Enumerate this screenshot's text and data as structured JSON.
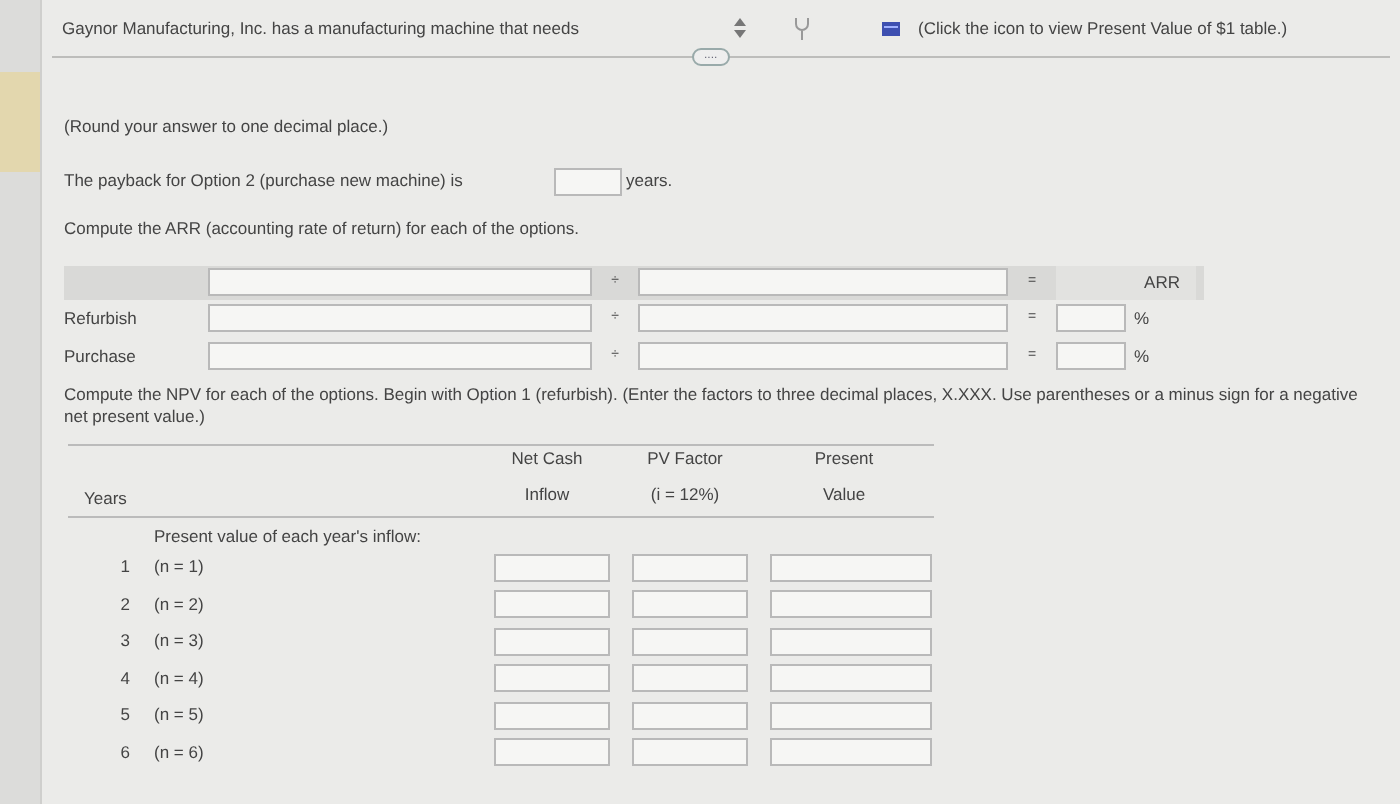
{
  "header": {
    "title": "Gaynor Manufacturing, Inc. has a manufacturing machine that needs",
    "more": "....",
    "table_link": "(Click the icon to view Present Value of $1 table.)"
  },
  "instruction": "(Round your answer to one decimal place.)",
  "payback": {
    "label": "The payback for Option 2 (purchase new machine) is",
    "unit": "years."
  },
  "arr": {
    "prompt": "Compute the ARR (accounting rate of return) for each of the options.",
    "divide": "÷",
    "equals": "=",
    "result_heading": "ARR",
    "rows": [
      {
        "label": "Refurbish",
        "divide": "÷",
        "equals": "=",
        "unit": "%"
      },
      {
        "label": "Purchase",
        "divide": "÷",
        "equals": "=",
        "unit": "%"
      }
    ]
  },
  "npv": {
    "prompt": "Compute the NPV for each of the options. Begin with Option 1 (refurbish). (Enter the factors to three decimal places, X.XXX. Use parentheses or a minus sign for a negative net present value.)",
    "columns": [
      {
        "line2": "Years"
      },
      {
        "line1": "Net Cash",
        "line2": "Inflow"
      },
      {
        "line1": "PV Factor",
        "line2": "(i = 12%)"
      },
      {
        "line1": "Present",
        "line2": "Value"
      }
    ],
    "section": "Present value of each year's inflow:",
    "rows": [
      {
        "year": "1",
        "period": "(n = 1)"
      },
      {
        "year": "2",
        "period": "(n = 2)"
      },
      {
        "year": "3",
        "period": "(n = 3)"
      },
      {
        "year": "4",
        "period": "(n = 4)"
      },
      {
        "year": "5",
        "period": "(n = 5)"
      },
      {
        "year": "6",
        "period": "(n = 6)"
      }
    ]
  }
}
